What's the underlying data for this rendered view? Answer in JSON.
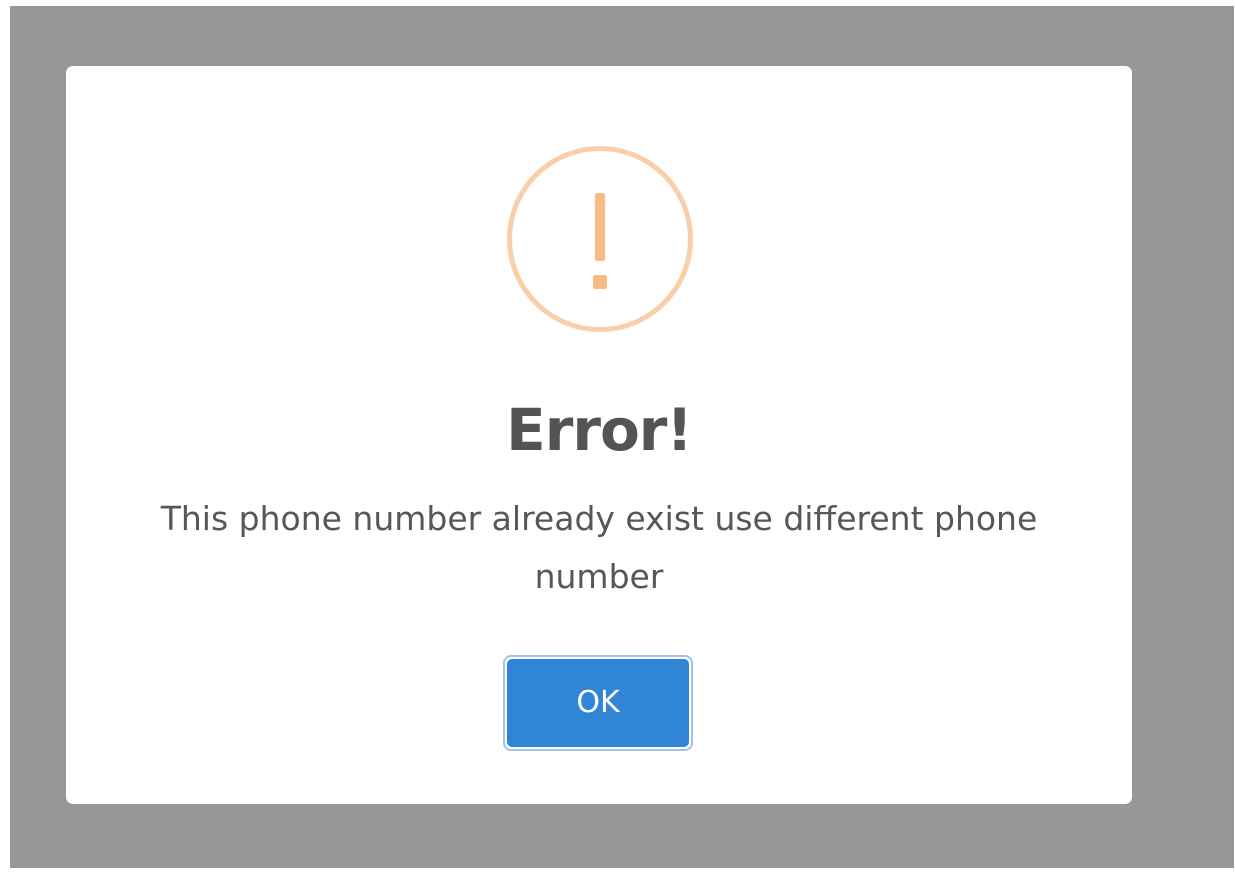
{
  "dialog": {
    "icon": "warning-exclamation-icon",
    "title": "Error!",
    "message": "This phone number already exist use different phone number",
    "confirm_label": "OK"
  },
  "colors": {
    "overlay": "#979797",
    "dialog_background": "#ffffff",
    "icon_ring": "#facea8",
    "icon_mark": "#f8bb86",
    "title_text": "#545454",
    "message_text": "#575757",
    "confirm_button": "#3085d6",
    "confirm_focus_ring": "#a6c2e3"
  }
}
